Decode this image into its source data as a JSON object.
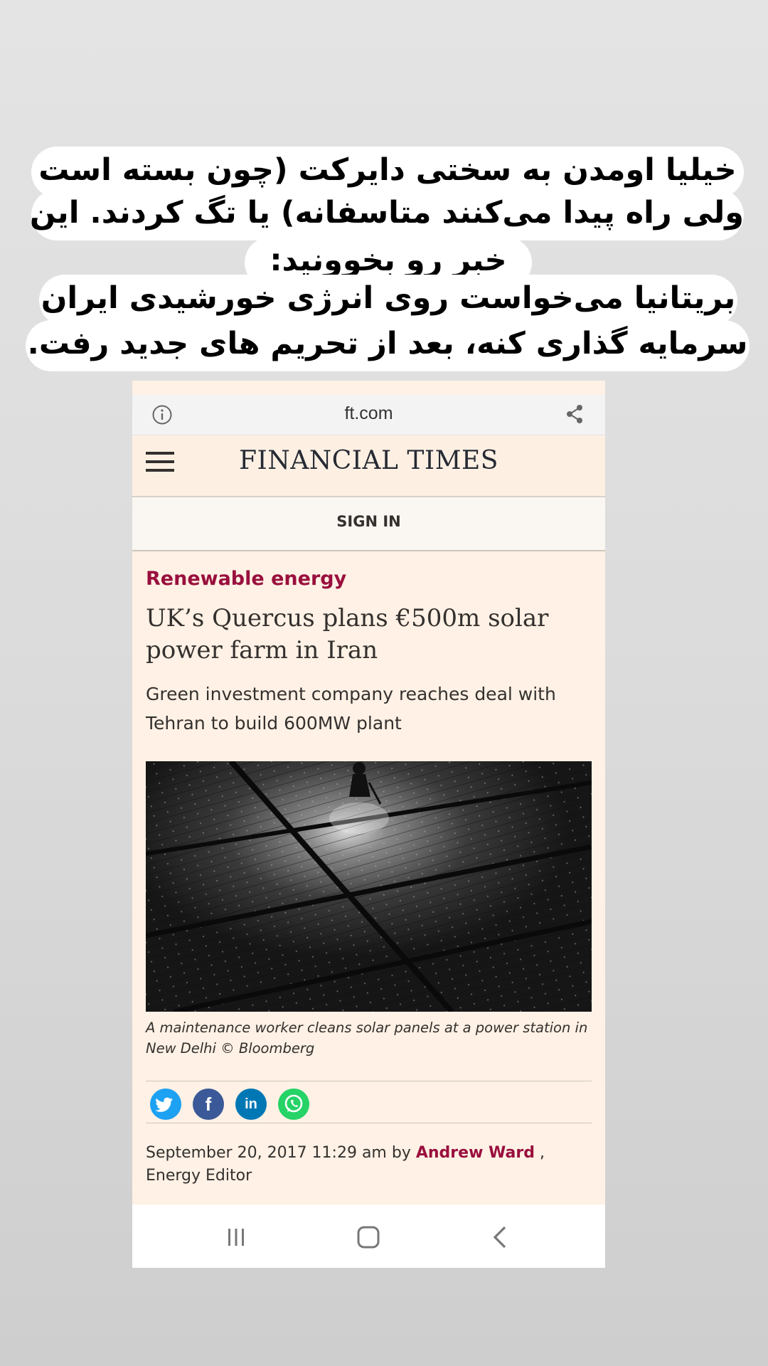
{
  "overlay": {
    "lines": [
      "خیلیا اومدن به سختی دایرکت (چون بسته است",
      "ولی راه پیدا می‌کنند متاسفانه) یا تگ کردند. این",
      "خبر رو بخوونید:",
      "بریتانیا می‌خواست روی انرژی خورشیدی ایران",
      "سرمایه گذاری کنه، بعد از تحریم های جدید رفت."
    ]
  },
  "browser": {
    "url": "ft.com",
    "info_icon": "info-icon",
    "share_icon": "share-icon"
  },
  "site": {
    "logo": "FINANCIAL TIMES",
    "menu_icon": "hamburger-menu-icon",
    "sign_in": "SIGN IN"
  },
  "article": {
    "topic": "Renewable energy",
    "headline": "UK’s Quercus plans €500m solar power farm in Iran",
    "standfirst": "Green investment company reaches deal with Tehran to build 600MW plant",
    "image_caption": "A maintenance worker cleans solar panels at a power station in New Delhi © Bloomberg",
    "share": [
      "twitter-icon",
      "facebook-icon",
      "linkedin-icon",
      "whatsapp-icon"
    ],
    "byline": {
      "date": "September 20, 2017 11:29 am",
      "by": "by",
      "author": "Andrew Ward",
      "role": ", Energy Editor"
    }
  },
  "colors": {
    "ft_background": "#fff1e5",
    "ft_claret": "#990f3d",
    "twitter": "#1da1f2",
    "facebook": "#3b5998",
    "linkedin": "#0077b5",
    "whatsapp": "#25d366"
  },
  "navbar": [
    "recent-apps-icon",
    "home-icon",
    "back-icon"
  ]
}
